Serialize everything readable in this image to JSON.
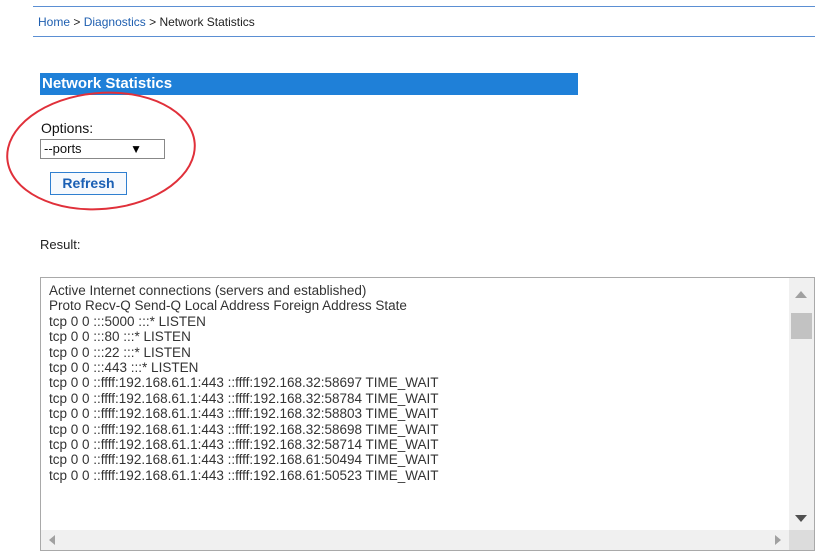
{
  "breadcrumb": {
    "home": "Home",
    "diagnostics": "Diagnostics",
    "current": "Network Statistics",
    "separator": ">"
  },
  "section": {
    "title": "Network Statistics"
  },
  "options": {
    "label": "Options:",
    "selected": "--ports",
    "arrow": "▼"
  },
  "refresh_label": "Refresh",
  "result": {
    "label": "Result:",
    "lines": [
      "Active Internet connections (servers and established)",
      "Proto Recv-Q Send-Q Local Address Foreign Address State",
      "tcp 0 0 :::5000 :::* LISTEN",
      "tcp 0 0 :::80 :::* LISTEN",
      "tcp 0 0 :::22 :::* LISTEN",
      "tcp 0 0 :::443 :::* LISTEN",
      "tcp 0 0 ::ffff:192.168.61.1:443 ::ffff:192.168.32:58697 TIME_WAIT",
      "tcp 0 0 ::ffff:192.168.61.1:443 ::ffff:192.168.32:58784 TIME_WAIT",
      "tcp 0 0 ::ffff:192.168.61.1:443 ::ffff:192.168.32:58803 TIME_WAIT",
      "tcp 0 0 ::ffff:192.168.61.1:443 ::ffff:192.168.32:58698 TIME_WAIT",
      "tcp 0 0 ::ffff:192.168.61.1:443 ::ffff:192.168.32:58714 TIME_WAIT",
      "tcp 0 0 ::ffff:192.168.61.1:443 ::ffff:192.168.61:50494 TIME_WAIT",
      "tcp 0 0 ::ffff:192.168.61.1:443 ::ffff:192.168.61:50523 TIME_WAIT"
    ]
  },
  "colors": {
    "header_bg": "#1f80d8",
    "link": "#1f5fb0",
    "highlight": "#e0303a"
  }
}
